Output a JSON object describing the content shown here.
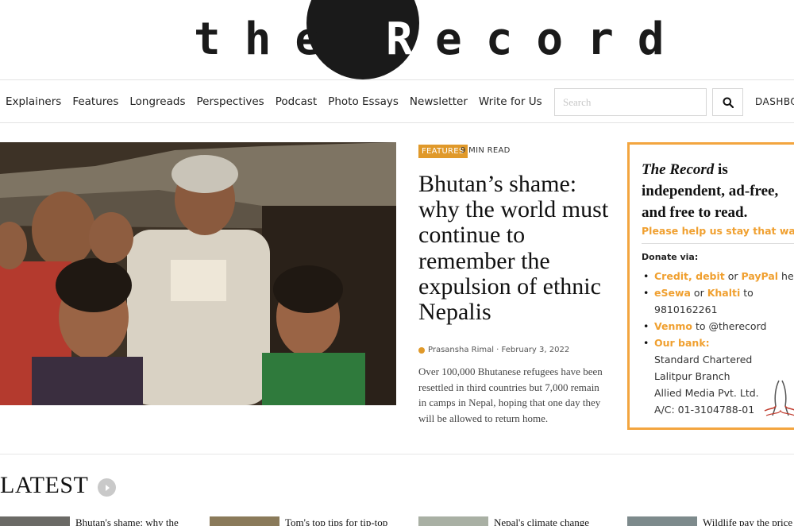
{
  "logo": {
    "the": "the",
    "r": "R",
    "ecord": "ecord"
  },
  "nav": {
    "links": [
      "Explainers",
      "Features",
      "Longreads",
      "Perspectives",
      "Podcast",
      "Photo Essays",
      "Newsletter",
      "Write for Us"
    ],
    "search_placeholder": "Search",
    "dashboard_label": "DASHBOARD"
  },
  "hero": {
    "category": "FEATURES",
    "read_time": "9 MIN READ",
    "headline": "Bhutan’s shame: why the world must continue to remember the expulsion of ethnic Nepalis",
    "byline": "Prasansha Rimal · February 3, 2022",
    "excerpt": "Over 100,000 Bhutanese refugees have been resettled in third countries but 7,000 remain in camps in Nepal, hoping that one day they will be allowed to return home."
  },
  "donate": {
    "brand": "The Record",
    "line1_rest": " is",
    "line2": "independent, ad-free,",
    "line3": "and free to read.",
    "help": "Please help us stay that way",
    "via": "Donate via:",
    "credit": "Credit, debit",
    "or1": " or ",
    "paypal": "PayPal",
    "here": " here",
    "esewa": "eSewa",
    "or2": " or ",
    "khalti": "Khalti",
    "to1": " to",
    "phone": "9810162261",
    "venmo": "Venmo",
    "venmo_handle": " to @therecord",
    "bank_label": "Our bank:",
    "bank_name": "Standard Chartered",
    "bank_branch": "Lalitpur Branch",
    "account_name": "Allied Media Pvt. Ltd.",
    "account_no": "A/C: 01-3104788-01"
  },
  "latest": {
    "heading": "LATEST",
    "items": [
      {
        "title": "Bhutan's shame: why the"
      },
      {
        "title": "Tom's top tips for tip-top"
      },
      {
        "title": "Nepal's climate change"
      },
      {
        "title": "Wildlife pay the price"
      }
    ]
  },
  "colors": {
    "accent": "#e0992a",
    "donate_border": "#f3a53f",
    "logo_dark": "#1a1a1a"
  }
}
